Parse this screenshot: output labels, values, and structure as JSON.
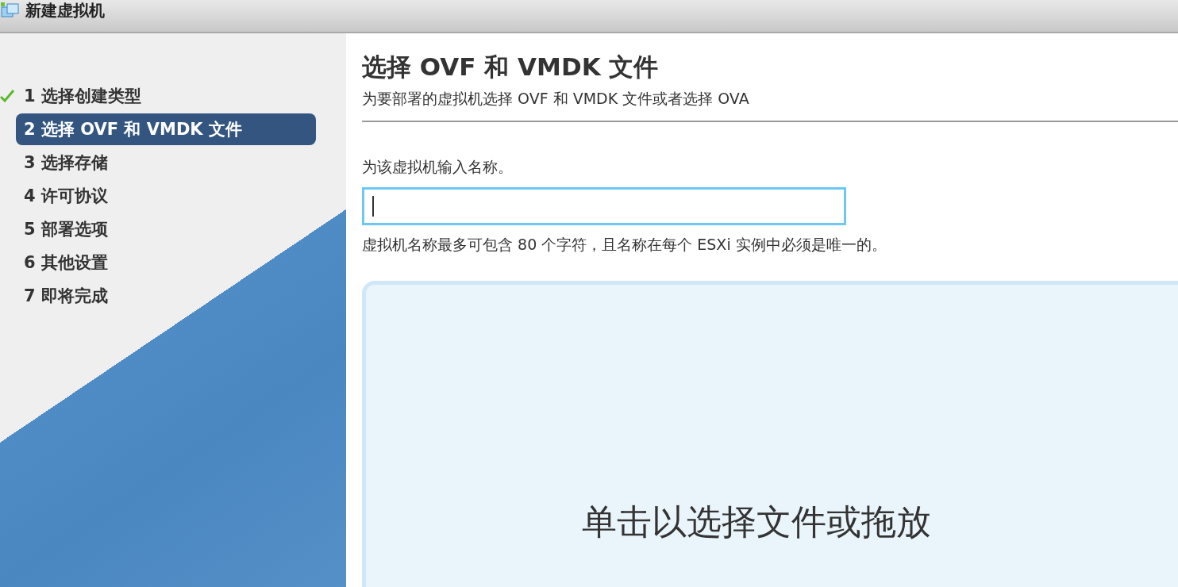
{
  "window": {
    "title": "新建虚拟机"
  },
  "steps": [
    {
      "label": "1 选择创建类型",
      "completed": true,
      "selected": false
    },
    {
      "label": "2 选择 OVF 和 VMDK 文件",
      "completed": false,
      "selected": true
    },
    {
      "label": "3 选择存储",
      "completed": false,
      "selected": false
    },
    {
      "label": "4 许可协议",
      "completed": false,
      "selected": false
    },
    {
      "label": "5 部署选项",
      "completed": false,
      "selected": false
    },
    {
      "label": "6 其他设置",
      "completed": false,
      "selected": false
    },
    {
      "label": "7 即将完成",
      "completed": false,
      "selected": false
    }
  ],
  "page": {
    "title": "选择 OVF 和 VMDK 文件",
    "subtitle": "为要部署的虚拟机选择 OVF 和 VMDK 文件或者选择 OVA"
  },
  "name_field": {
    "label": "为该虚拟机输入名称。",
    "focused": true,
    "hint": "虚拟机名称最多可包含 80 个字符，且名称在每个 ESXi 实例中必须是唯一的。"
  },
  "drop_zone": {
    "text": "单击以选择文件或拖放"
  }
}
